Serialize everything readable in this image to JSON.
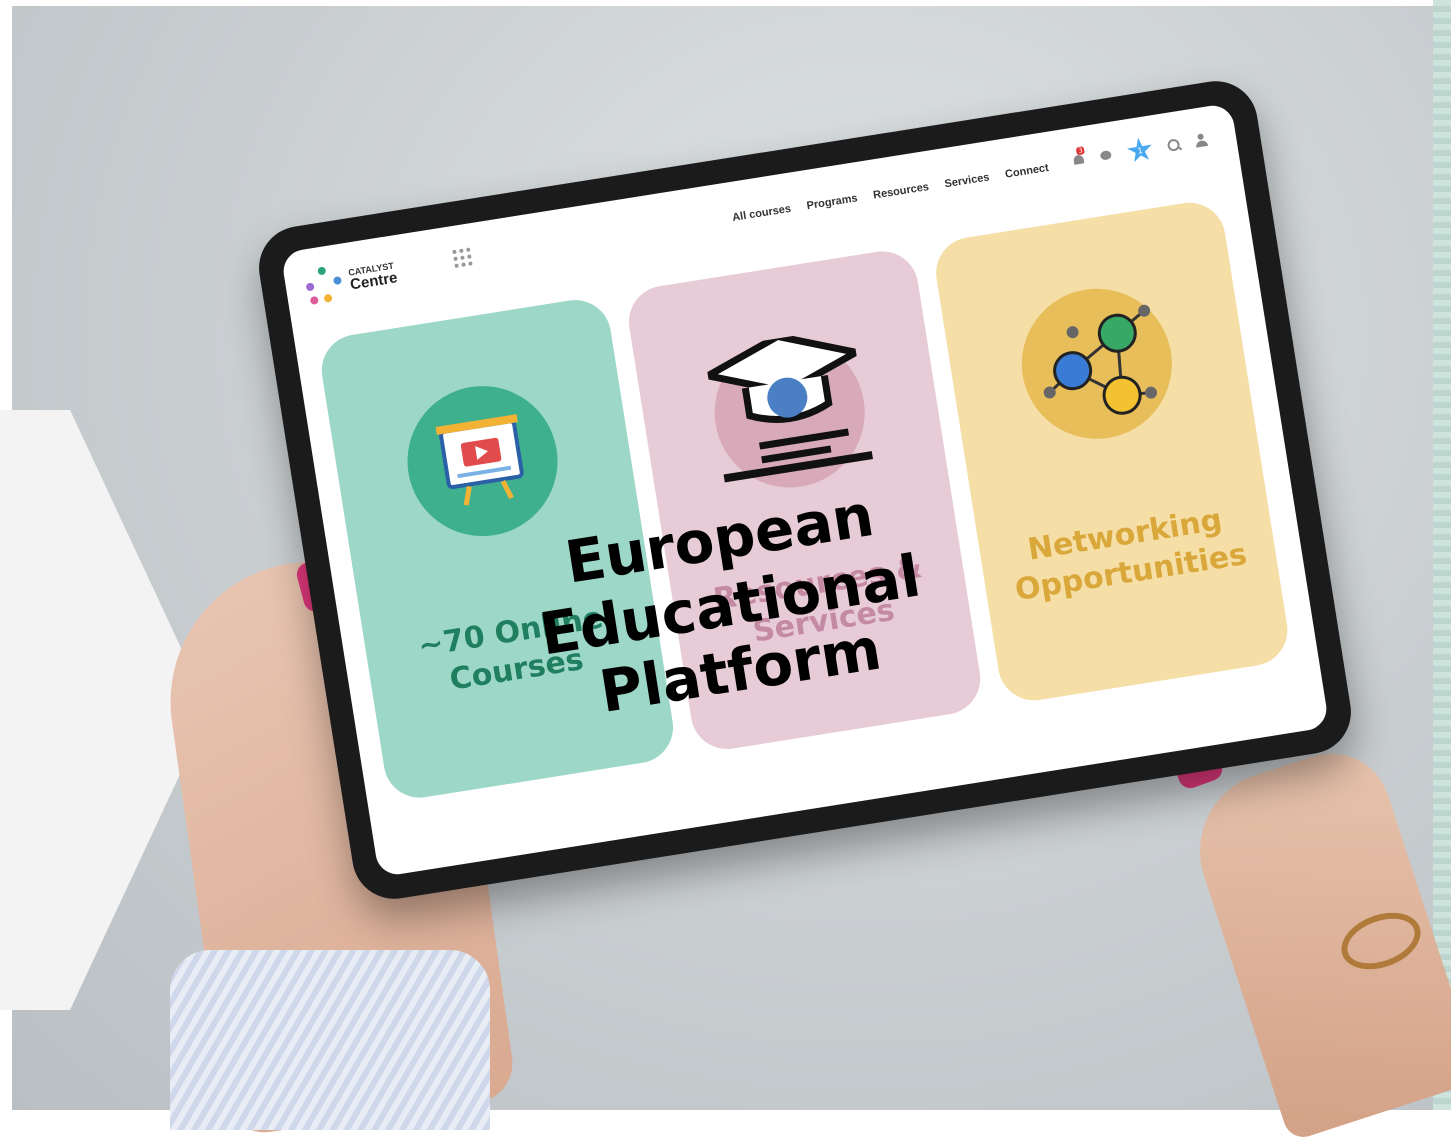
{
  "header": {
    "logo_top": "CATALYST",
    "logo_bottom": "Centre",
    "nav": [
      "All courses",
      "Programs",
      "Resources",
      "Services",
      "Connect"
    ],
    "notification_count": "3",
    "star_count": "1"
  },
  "cards": [
    {
      "title": "~70 Online Courses",
      "icon": "presentation-board-icon"
    },
    {
      "title": "Resources & Services",
      "icon": "graduation-cap-browser-icon"
    },
    {
      "title": "Networking Opportunities",
      "icon": "network-people-icon"
    }
  ],
  "overlay": {
    "title": "European Educational Platform"
  }
}
